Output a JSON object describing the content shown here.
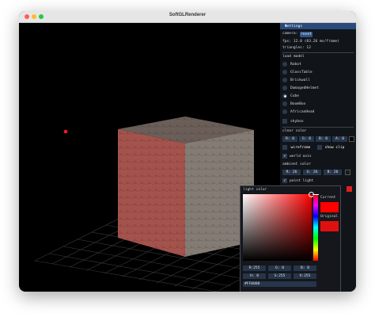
{
  "window": {
    "title": "SoftGLRenderer"
  },
  "settings": {
    "title": "Settings",
    "camera_label": "camera:",
    "reset_label": "reset",
    "fps_text": "fps: 12.0 (83.26 ms/frame)",
    "triangles_text": "triangles: 12",
    "load_model_label": "load model",
    "models": [
      "Robot",
      "GlassTable",
      "Brickwall",
      "DamagedHelmet",
      "Cube",
      "BoomBox",
      "AfricanHead"
    ],
    "selected_model": "Cube",
    "skybox_label": "skybox",
    "clear_color_label": "clear color",
    "clear_color_fields": [
      "R: 0",
      "G: 0",
      "B: 0",
      "A: 0"
    ],
    "wireframe_label": "wireframe",
    "show_clip_label": "show clip",
    "world_axis_label": "world axis",
    "ambient_color_label": "ambient color",
    "ambient_fields": [
      "R: 26",
      "G: 26",
      "B: 26"
    ],
    "point_light_label": "point light",
    "color_label": "color",
    "accent": "#2d5486",
    "swatch_color": "#e02020"
  },
  "picker": {
    "title": "light color",
    "current_label": "Current",
    "original_label": "Original",
    "rgb_fields": [
      "R:255",
      "G:  0",
      "B:  0"
    ],
    "hsv_fields": [
      "H:  0",
      "S:255",
      "V:255"
    ],
    "hex_value": "#FF0000"
  },
  "icons": {
    "collapse": "triangle-down-icon",
    "check": "checkmark-icon"
  }
}
